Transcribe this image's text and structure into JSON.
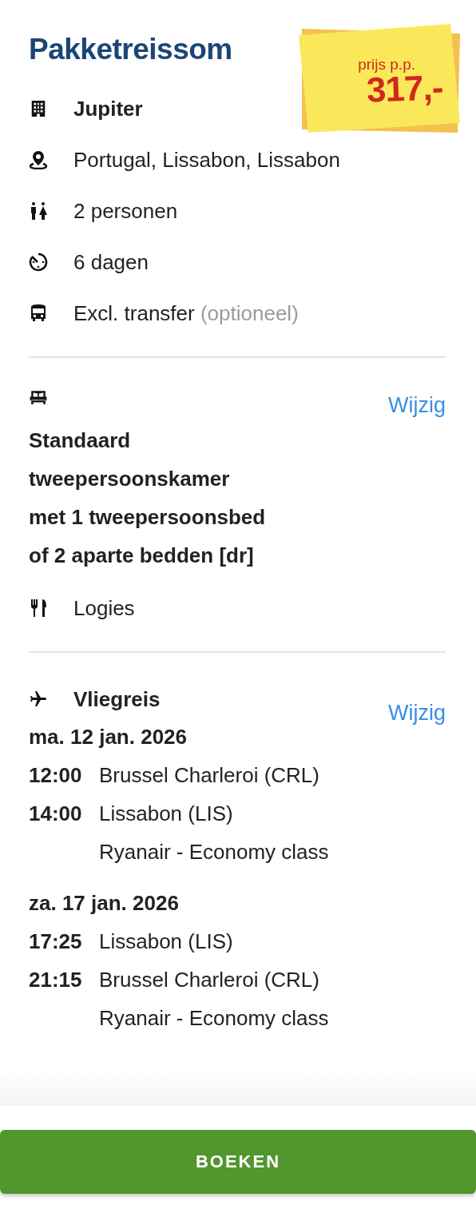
{
  "title": "Pakketreissom",
  "price": {
    "label": "prijs p.p.",
    "amount": "317,-"
  },
  "details": [
    {
      "kind": "hotel",
      "text": "Jupiter",
      "bold": true
    },
    {
      "kind": "location",
      "text": "Portugal, Lissabon, Lissabon",
      "bold": false
    },
    {
      "kind": "travellers",
      "text": "2 personen",
      "bold": false
    },
    {
      "kind": "duration",
      "text": "6 dagen",
      "bold": false
    },
    {
      "kind": "transfer",
      "text": "Excl. transfer",
      "note": "(optioneel)",
      "bold": false
    }
  ],
  "room": {
    "action": "Wijzig",
    "name_lines": [
      "Standaard",
      "tweepersoonskamer",
      "met 1 tweepersoonsbed",
      "of 2 aparte bedden [dr]"
    ],
    "board": {
      "text": "Logies"
    }
  },
  "flight": {
    "title": "Vliegreis",
    "action": "Wijzig",
    "legs": [
      {
        "date": "ma. 12 jan. 2026",
        "segments": [
          {
            "time": "12:00",
            "place": "Brussel Charleroi (CRL)"
          },
          {
            "time": "14:00",
            "place": "Lissabon (LIS)"
          }
        ],
        "carrier": "Ryanair - Economy class"
      },
      {
        "date": "za. 17 jan. 2026",
        "segments": [
          {
            "time": "17:25",
            "place": "Lissabon (LIS)"
          },
          {
            "time": "21:15",
            "place": "Brussel Charleroi (CRL)"
          }
        ],
        "carrier": "Ryanair - Economy class"
      }
    ]
  },
  "button": "BOEKEN"
}
